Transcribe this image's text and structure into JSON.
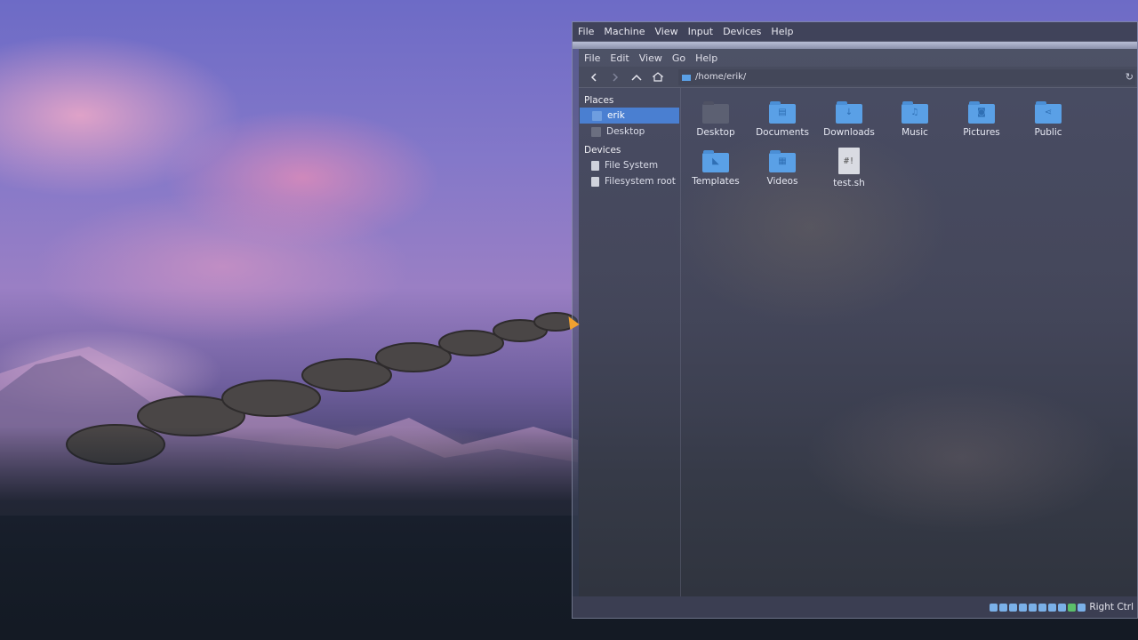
{
  "vm": {
    "menu": [
      "File",
      "Machine",
      "View",
      "Input",
      "Devices",
      "Help"
    ],
    "status_key": "Right Ctrl"
  },
  "file_manager": {
    "menu": [
      "File",
      "Edit",
      "View",
      "Go",
      "Help"
    ],
    "path": "/home/erik/",
    "sidebar": {
      "places_header": "Places",
      "places": [
        {
          "label": "erik",
          "icon": "home-folder-icon",
          "selected": true
        },
        {
          "label": "Desktop",
          "icon": "desktop-folder-icon",
          "selected": false
        }
      ],
      "devices_header": "Devices",
      "devices": [
        {
          "label": "File System",
          "icon": "drive-icon"
        },
        {
          "label": "Filesystem root",
          "icon": "drive-icon"
        }
      ]
    },
    "items": [
      {
        "label": "Desktop",
        "icon": "desktop-folder-icon"
      },
      {
        "label": "Documents",
        "icon": "documents-folder-icon"
      },
      {
        "label": "Downloads",
        "icon": "downloads-folder-icon"
      },
      {
        "label": "Music",
        "icon": "music-folder-icon"
      },
      {
        "label": "Pictures",
        "icon": "pictures-folder-icon"
      },
      {
        "label": "Public",
        "icon": "public-folder-icon"
      },
      {
        "label": "Templates",
        "icon": "templates-folder-icon"
      },
      {
        "label": "Videos",
        "icon": "videos-folder-icon"
      },
      {
        "label": "test.sh",
        "icon": "shell-script-icon"
      }
    ]
  },
  "colors": {
    "selection": "#4a7fd1",
    "folder": "#5aa0e6"
  }
}
